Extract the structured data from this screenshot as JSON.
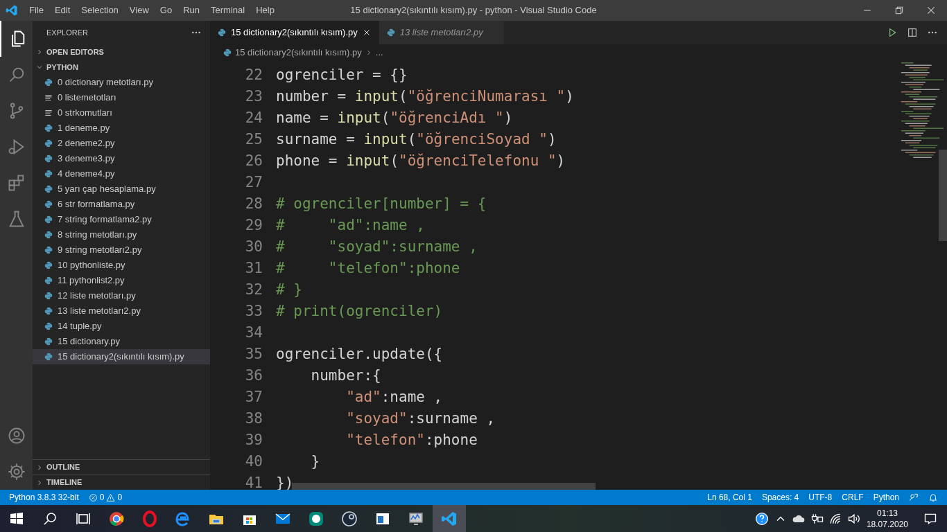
{
  "window": {
    "title": "15 dictionary2(sıkıntılı kısım).py - python - Visual Studio Code"
  },
  "menu": [
    "File",
    "Edit",
    "Selection",
    "View",
    "Go",
    "Run",
    "Terminal",
    "Help"
  ],
  "sidebar": {
    "title": "EXPLORER",
    "sections": [
      {
        "label": "OPEN EDITORS",
        "expanded": false
      },
      {
        "label": "PYTHON",
        "expanded": true
      }
    ],
    "files": [
      {
        "name": "0 dictionary metotları.py",
        "kind": "python",
        "selected": false
      },
      {
        "name": "0 listemetotları",
        "kind": "text",
        "selected": false
      },
      {
        "name": "0 strkomutları",
        "kind": "text",
        "selected": false
      },
      {
        "name": "1 deneme.py",
        "kind": "python",
        "selected": false
      },
      {
        "name": "2 deneme2.py",
        "kind": "python",
        "selected": false
      },
      {
        "name": "3 deneme3.py",
        "kind": "python",
        "selected": false
      },
      {
        "name": "4 deneme4.py",
        "kind": "python",
        "selected": false
      },
      {
        "name": "5 yarı çap hesaplama.py",
        "kind": "python",
        "selected": false
      },
      {
        "name": "6 str formatlama.py",
        "kind": "python",
        "selected": false
      },
      {
        "name": "7 string formatlama2.py",
        "kind": "python",
        "selected": false
      },
      {
        "name": "8 string metotları.py",
        "kind": "python",
        "selected": false
      },
      {
        "name": "9 string metotları2.py",
        "kind": "python",
        "selected": false
      },
      {
        "name": "10 pythonliste.py",
        "kind": "python",
        "selected": false
      },
      {
        "name": "11 pythonlist2.py",
        "kind": "python",
        "selected": false
      },
      {
        "name": "12 liste metotları.py",
        "kind": "python",
        "selected": false
      },
      {
        "name": "13 liste metotları2.py",
        "kind": "python",
        "selected": false
      },
      {
        "name": "14 tuple.py",
        "kind": "python",
        "selected": false
      },
      {
        "name": "15 dictionary.py",
        "kind": "python",
        "selected": false
      },
      {
        "name": "15 dictionary2(sıkıntılı kısım).py",
        "kind": "python",
        "selected": true
      }
    ],
    "bottom_sections": [
      {
        "label": "OUTLINE",
        "expanded": false
      },
      {
        "label": "TIMELINE",
        "expanded": false
      }
    ]
  },
  "tabs": [
    {
      "label": "15 dictionary2(sıkıntılı kısım).py",
      "selected": true,
      "preview": false
    },
    {
      "label": "13 liste metotları2.py",
      "selected": false,
      "preview": true
    }
  ],
  "breadcrumb": [
    "15 dictionary2(sıkıntılı kısım).py",
    "..."
  ],
  "code": [
    {
      "number": "22",
      "tokens": [
        {
          "text": "ogrenciler = {}",
          "kind": "plain"
        }
      ]
    },
    {
      "number": "23",
      "tokens": [
        {
          "text": "number = ",
          "kind": "plain"
        },
        {
          "text": "input",
          "kind": "func"
        },
        {
          "text": "(",
          "kind": "plain"
        },
        {
          "text": "\"öğrenciNumarası \"",
          "kind": "string"
        },
        {
          "text": ")",
          "kind": "plain"
        }
      ]
    },
    {
      "number": "24",
      "tokens": [
        {
          "text": "name = ",
          "kind": "plain"
        },
        {
          "text": "input",
          "kind": "func"
        },
        {
          "text": "(",
          "kind": "plain"
        },
        {
          "text": "\"öğrenciAdı \"",
          "kind": "string"
        },
        {
          "text": ")",
          "kind": "plain"
        }
      ]
    },
    {
      "number": "25",
      "tokens": [
        {
          "text": "surname = ",
          "kind": "plain"
        },
        {
          "text": "input",
          "kind": "func"
        },
        {
          "text": "(",
          "kind": "plain"
        },
        {
          "text": "\"öğrenciSoyad \"",
          "kind": "string"
        },
        {
          "text": ")",
          "kind": "plain"
        }
      ]
    },
    {
      "number": "26",
      "tokens": [
        {
          "text": "phone = ",
          "kind": "plain"
        },
        {
          "text": "input",
          "kind": "func"
        },
        {
          "text": "(",
          "kind": "plain"
        },
        {
          "text": "\"öğrenciTelefonu \"",
          "kind": "string"
        },
        {
          "text": ")",
          "kind": "plain"
        }
      ]
    },
    {
      "number": "27"
    },
    {
      "number": "28",
      "tokens": [
        {
          "text": "# ogrenciler[number] = {",
          "kind": "comment"
        }
      ]
    },
    {
      "number": "29",
      "tokens": [
        {
          "text": "#     \"ad\":name ,",
          "kind": "comment"
        }
      ]
    },
    {
      "number": "30",
      "tokens": [
        {
          "text": "#     \"soyad\":surname ,",
          "kind": "comment"
        }
      ]
    },
    {
      "number": "31",
      "tokens": [
        {
          "text": "#     \"telefon\":phone",
          "kind": "comment"
        }
      ]
    },
    {
      "number": "32",
      "tokens": [
        {
          "text": "# }",
          "kind": "comment"
        }
      ]
    },
    {
      "number": "33",
      "tokens": [
        {
          "text": "# print(ogrenciler)",
          "kind": "comment"
        }
      ]
    },
    {
      "number": "34"
    },
    {
      "number": "35",
      "tokens": [
        {
          "text": "ogrenciler.update({",
          "kind": "plain"
        }
      ]
    },
    {
      "number": "36",
      "tokens": [
        {
          "text": "    number:{",
          "kind": "plain"
        }
      ]
    },
    {
      "number": "37",
      "tokens": [
        {
          "text": "        \"ad\"",
          "kind": "string"
        },
        {
          "text": ":name ,",
          "kind": "plain"
        }
      ]
    },
    {
      "number": "38",
      "tokens": [
        {
          "text": "        \"soyad\"",
          "kind": "string"
        },
        {
          "text": ":surname ,",
          "kind": "plain"
        }
      ]
    },
    {
      "number": "39",
      "tokens": [
        {
          "text": "        \"telefon\"",
          "kind": "string"
        },
        {
          "text": ":phone",
          "kind": "plain"
        }
      ]
    },
    {
      "number": "40",
      "tokens": [
        {
          "text": "    }",
          "kind": "plain"
        }
      ]
    },
    {
      "number": "41",
      "tokens": [
        {
          "text": "})",
          "kind": "plain"
        }
      ]
    }
  ],
  "status_bar": {
    "left": [
      "Python 3.8.3 32-bit"
    ],
    "problems": {
      "errors": "0",
      "warnings": "0"
    },
    "right": [
      "Ln 68, Col 1",
      "Spaces: 4",
      "UTF-8",
      "CRLF",
      "Python"
    ]
  },
  "taskbar": {
    "time": "01:13",
    "date": "18.07.2020"
  }
}
